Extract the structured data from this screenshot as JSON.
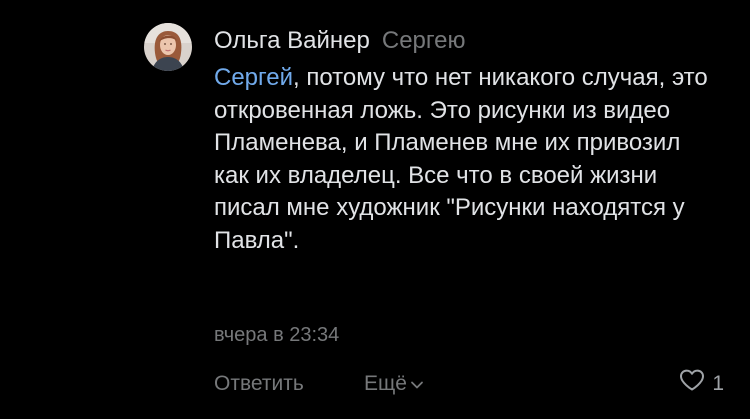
{
  "comment": {
    "author_name": "Ольга Вайнер",
    "reply_to": "Сергею",
    "mention": "Сергей",
    "text": ", потому что нет никакого случая, это откровенная ложь. Это рисунки из видео Пламенева, и Пламенев мне их привозил как их владелец. Все что в своей жизни писал мне художник \"Рисунки находятся у Павла\".",
    "timestamp": "вчера в 23:34"
  },
  "actions": {
    "reply_label": "Ответить",
    "more_label": "Ещё",
    "like_count": "1"
  },
  "icons": {
    "more": "chevron-down-icon",
    "like": "heart-outline-icon"
  },
  "colors": {
    "background": "#000000",
    "text_primary": "#e1e3e6",
    "text_secondary": "#76787a",
    "link": "#71aaeb"
  }
}
